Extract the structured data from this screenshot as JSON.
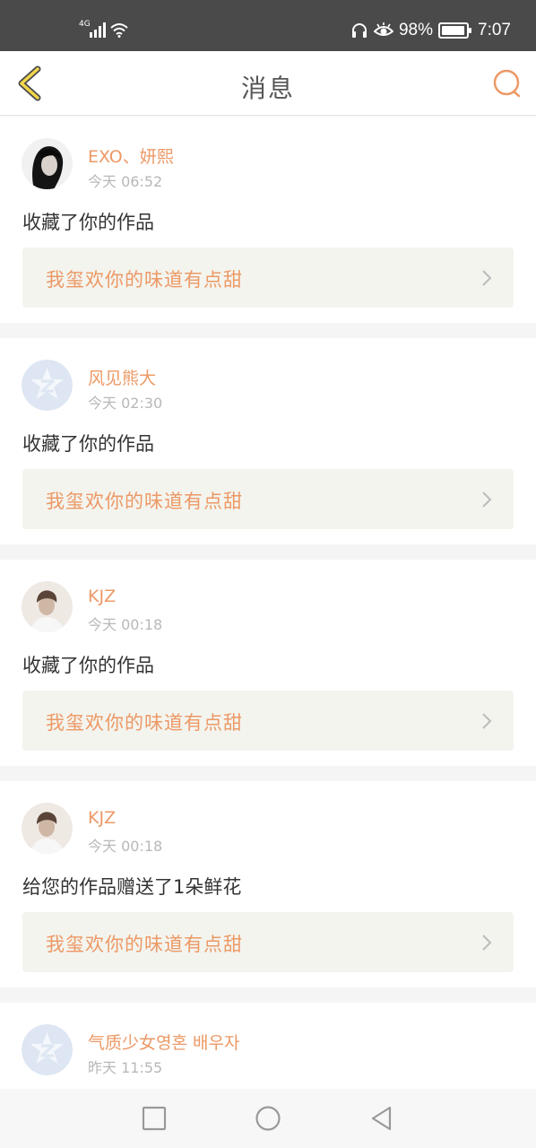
{
  "status_bar": {
    "network": "4G",
    "battery": "98%",
    "battery_level": 0.98,
    "time": "7:07",
    "icons": [
      "signal-icon",
      "wifi-icon",
      "headphone-icon",
      "eye-icon",
      "battery-icon"
    ]
  },
  "header": {
    "title": "消息",
    "back_icon": "chevron-left-icon",
    "search_icon": "search-icon"
  },
  "colors": {
    "accent": "#ec9966",
    "back_arrow": "#f2d64b",
    "card_link_bg": "#f4f4ee"
  },
  "messages": [
    {
      "user": "EXO、妍熙",
      "time": "今天 06:52",
      "action": "收藏了你的作品",
      "work": "我玺欢你的味道有点甜",
      "avatar": "photo"
    },
    {
      "user": "风见熊大",
      "time": "今天 02:30",
      "action": "收藏了你的作品",
      "work": "我玺欢你的味道有点甜",
      "avatar": "default"
    },
    {
      "user": "KJZ",
      "time": "今天 00:18",
      "action": "收藏了你的作品",
      "work": "我玺欢你的味道有点甜",
      "avatar": "photo"
    },
    {
      "user": "KJZ",
      "time": "今天 00:18",
      "action": "给您的作品赠送了1朵鲜花",
      "work": "我玺欢你的味道有点甜",
      "avatar": "photo"
    },
    {
      "user": "气质少女영혼 배우자",
      "time": "昨天 11:55",
      "action": "",
      "work": "",
      "avatar": "default"
    }
  ],
  "nav": {
    "icons": [
      "recent-apps-icon",
      "home-icon",
      "back-icon"
    ]
  }
}
